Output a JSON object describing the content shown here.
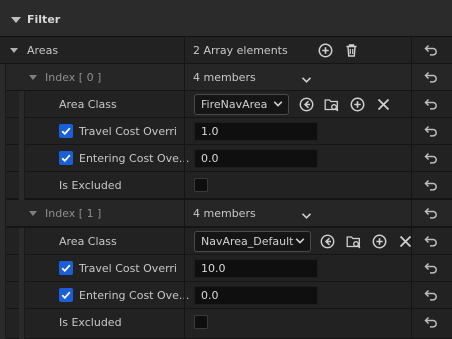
{
  "filter": {
    "title": "Filter"
  },
  "areas": {
    "label": "Areas",
    "summary": "2 Array elements"
  },
  "elements": [
    {
      "index_label": "Index [ 0 ]",
      "members": "4 members",
      "area_class_label": "Area Class",
      "area_class_value": "FireNavArea",
      "travel_cost_label": "Travel Cost Overri",
      "travel_cost_value": "1.0",
      "entering_cost_label": "Entering Cost Ove...",
      "entering_cost_value": "0.0",
      "is_excluded_label": "Is Excluded"
    },
    {
      "index_label": "Index [ 1 ]",
      "members": "4 members",
      "area_class_label": "Area Class",
      "area_class_value": "NavArea_Default",
      "travel_cost_label": "Travel Cost Overri",
      "travel_cost_value": "10.0",
      "entering_cost_label": "Entering Cost Ove...",
      "entering_cost_value": "0.0",
      "is_excluded_label": "Is Excluded"
    }
  ],
  "colors": {
    "accent": "#1b5fd6",
    "panel": "#222222",
    "field": "#0f0f0f"
  },
  "icons": {
    "reset": "reset-to-default-icon",
    "add": "add-element-icon",
    "delete": "delete-icon",
    "use_selected": "use-selected-asset-icon",
    "browse": "browse-in-content-icon",
    "clear": "clear-icon",
    "chevron": "chevron-down-icon",
    "check": "checkmark-icon"
  }
}
